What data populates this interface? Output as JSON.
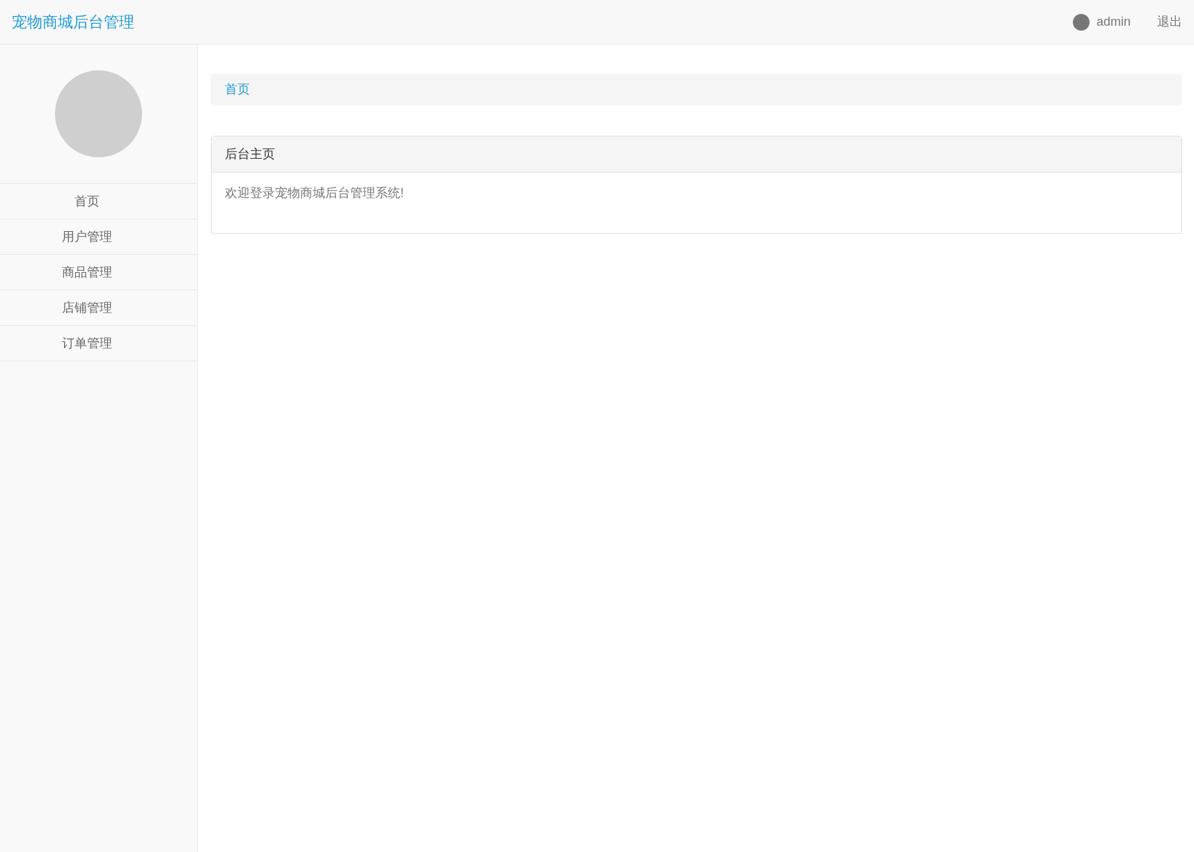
{
  "navbar": {
    "brand": "宠物商城后台管理",
    "user": "admin",
    "logout": "退出"
  },
  "sidebar": {
    "items": [
      {
        "label": "首页"
      },
      {
        "label": "用户管理"
      },
      {
        "label": "商品管理"
      },
      {
        "label": "店铺管理"
      },
      {
        "label": "订单管理"
      }
    ]
  },
  "breadcrumb": [
    "首页"
  ],
  "panel": {
    "title": "后台主页",
    "body": "欢迎登录宠物商城后台管理系统!"
  }
}
